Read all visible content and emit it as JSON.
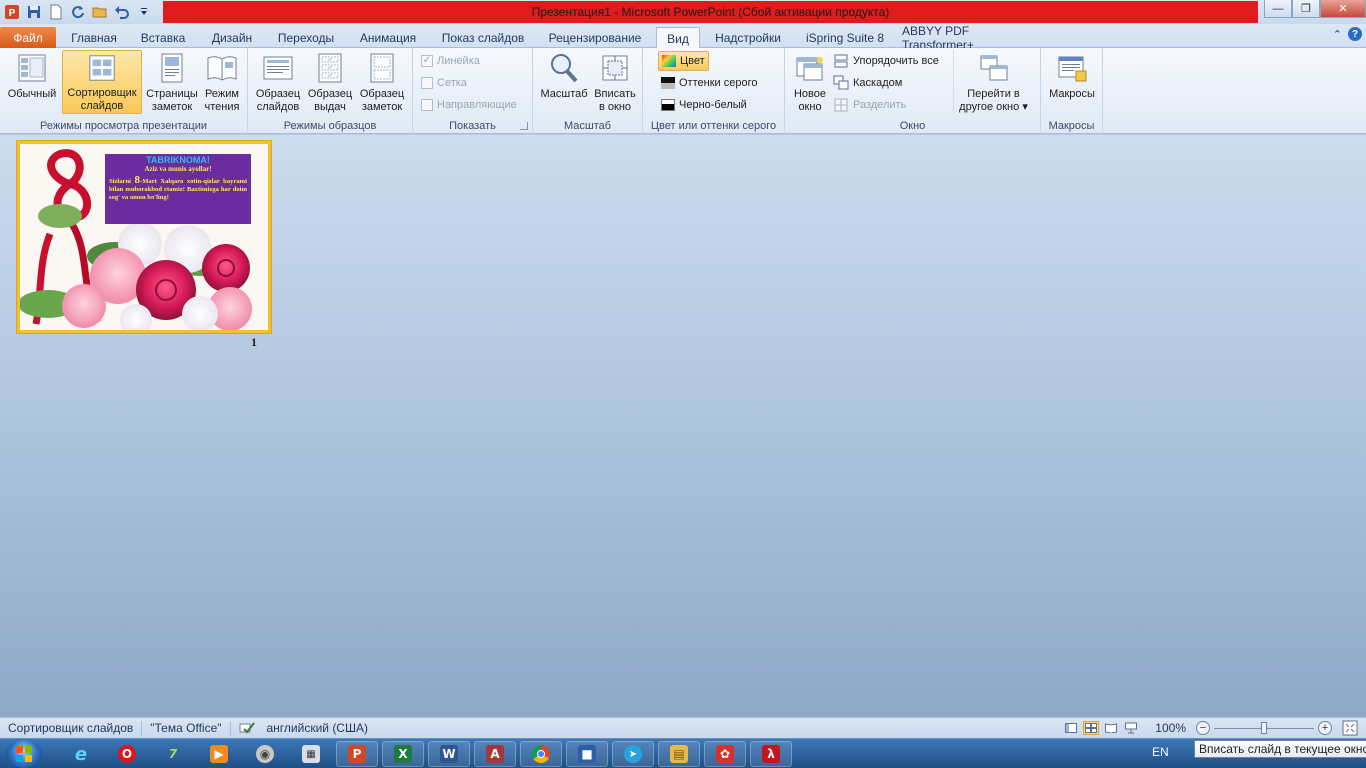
{
  "window": {
    "title": "Презентация1  -  Microsoft PowerPoint (Сбой активации продукта)",
    "title_bar_color": "#e01b1b"
  },
  "quick_access": [
    {
      "name": "app-icon",
      "icon": "powerpoint-icon"
    },
    {
      "name": "save",
      "icon": "save-icon"
    },
    {
      "name": "new",
      "icon": "new-document-icon"
    },
    {
      "name": "repeat",
      "icon": "refresh-icon"
    },
    {
      "name": "open",
      "icon": "open-folder-icon"
    },
    {
      "name": "undo",
      "icon": "undo-icon"
    },
    {
      "name": "customize",
      "icon": "dropdown-icon"
    }
  ],
  "tabs": [
    {
      "label": "Файл",
      "type": "file"
    },
    {
      "label": "Главная"
    },
    {
      "label": "Вставка"
    },
    {
      "label": "Дизайн"
    },
    {
      "label": "Переходы"
    },
    {
      "label": "Анимация"
    },
    {
      "label": "Показ слайдов"
    },
    {
      "label": "Рецензирование"
    },
    {
      "label": "Вид",
      "active": true
    },
    {
      "label": "Надстройки"
    },
    {
      "label": "iSpring Suite 8"
    },
    {
      "label": "ABBYY PDF Transformer+"
    }
  ],
  "ribbon": {
    "views": {
      "label": "Режимы просмотра презентации",
      "buttons": [
        "Обычный",
        "Сортировщик слайдов",
        "Страницы заметок",
        "Режим чтения"
      ],
      "selected": "Сортировщик слайдов"
    },
    "masters": {
      "label": "Режимы образцов",
      "buttons": [
        "Образец слайдов",
        "Образец выдач",
        "Образец заметок"
      ]
    },
    "show": {
      "label": "Показать",
      "items": [
        {
          "label": "Линейка",
          "checked": true,
          "enabled": false
        },
        {
          "label": "Сетка",
          "checked": false,
          "enabled": false
        },
        {
          "label": "Направляющие",
          "checked": false,
          "enabled": false
        }
      ]
    },
    "zoom": {
      "label": "Масштаб",
      "buttons": [
        "Масштаб",
        "Вписать в окно"
      ]
    },
    "color": {
      "label": "Цвет или оттенки серого",
      "items": [
        "Цвет",
        "Оттенки серого",
        "Черно-белый"
      ],
      "selected": "Цвет"
    },
    "window": {
      "label": "Окно",
      "new_window": "Новое окно",
      "arrange_all": "Упорядочить все",
      "cascade": "Каскадом",
      "split": "Разделить",
      "switch_windows": "Перейти в другое окно"
    },
    "macros": {
      "label": "Макросы",
      "button": "Макросы"
    }
  },
  "slides": [
    {
      "number": "1",
      "title": "TABRIKNOMA!",
      "subtitle": "Aziz va munis ayollar!",
      "body_pre": "Sizlarni ",
      "body_big": "8",
      "body_post": "-Mart Xalqaro xotin-qizlar bayrami bilan muborakbod etamiz! Baxtimizga har doim sog' va omon bo'ling!",
      "box_color": "#6a2c9e",
      "title_color": "#29c1f2",
      "text_color": "#ffe94d"
    }
  ],
  "status": {
    "view": "Сортировщик слайдов",
    "theme": "\"Тема Office\"",
    "language": "английский (США)",
    "zoom": "100%",
    "zoom_fraction": 0.5
  },
  "taskbar": {
    "lang": "EN",
    "apps": [
      "Internet Explorer",
      "Opera",
      "7-Zip",
      "Media Player",
      "Paint",
      "Calculator",
      "PowerPoint",
      "Excel",
      "Word",
      "Access",
      "Chrome",
      "Floppy",
      "Telegram",
      "Explorer",
      "Mail",
      "Acrobat"
    ]
  },
  "tooltip": "Вписать слайд в текущее окно"
}
